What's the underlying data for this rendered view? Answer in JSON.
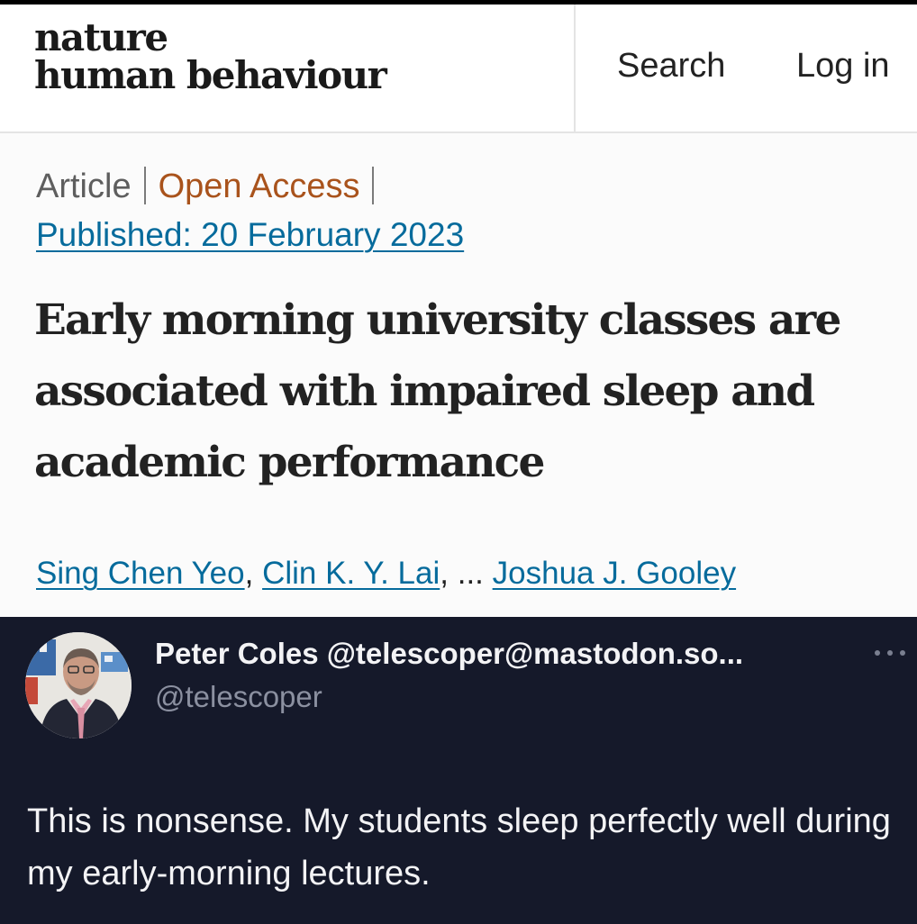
{
  "masthead": {
    "logo_line1": "nature",
    "logo_line2": "human behaviour",
    "search_label": "Search",
    "login_label": "Log in"
  },
  "article": {
    "type": "Article",
    "access": "Open Access",
    "published": "Published: 20 February 2023",
    "title": "Early morning university classes are associated with impaired sleep and academic performance",
    "authors": [
      "Sing Chen Yeo",
      "Clin K. Y. Lai",
      "Joshua J. Gooley"
    ],
    "author_separator": ",",
    "ellipsis": "..."
  },
  "post": {
    "display_name": "Peter Coles @telescoper@mastodon.so...",
    "handle": "@telescoper",
    "text": "This is nonsense. My students sleep perfectly well during my early-morning lectures.",
    "more_icon": "more-horizontal-icon"
  },
  "colors": {
    "link": "#066b9c",
    "open_access": "#a9531c",
    "post_background": "#15192a",
    "post_text": "#f3f3f5",
    "handle_text": "#8b90a0"
  }
}
